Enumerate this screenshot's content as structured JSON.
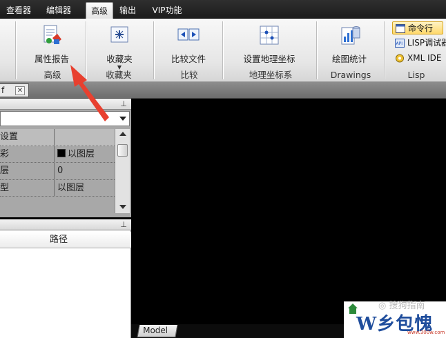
{
  "menu_tabs": [
    "查看器",
    "编辑器",
    "高级",
    "输出",
    "VIP功能"
  ],
  "active_tab": "高级",
  "ribbon": {
    "advanced": {
      "button": "属性报告",
      "title": "高级"
    },
    "favorites": {
      "button": "收藏夹",
      "title": "收藏夹"
    },
    "compare": {
      "button": "比较文件",
      "title": "比较"
    },
    "geo": {
      "button": "设置地理坐标",
      "title": "地理坐标系"
    },
    "drawings": {
      "button": "绘图统计",
      "title": "Drawings"
    },
    "lisp": {
      "items": [
        "命令行",
        "LISP调试器",
        "XML IDE"
      ],
      "title": "Lisp"
    }
  },
  "document_tab": {
    "label": "f",
    "close": "✕"
  },
  "properties": {
    "pin": "⊥",
    "rows": [
      {
        "name": "设置",
        "value": ""
      },
      {
        "name": "彩",
        "value": "以图层"
      },
      {
        "name": "层",
        "value": "0"
      },
      {
        "name": "型",
        "value": "以图层"
      }
    ]
  },
  "files_panel": {
    "pin": "⊥",
    "column": "路径"
  },
  "canvas": {
    "model_tab": "Model"
  },
  "watermark": {
    "brand": "W乡包愧",
    "url": "www.300w.com",
    "source": "◎ 搜狗指南"
  }
}
